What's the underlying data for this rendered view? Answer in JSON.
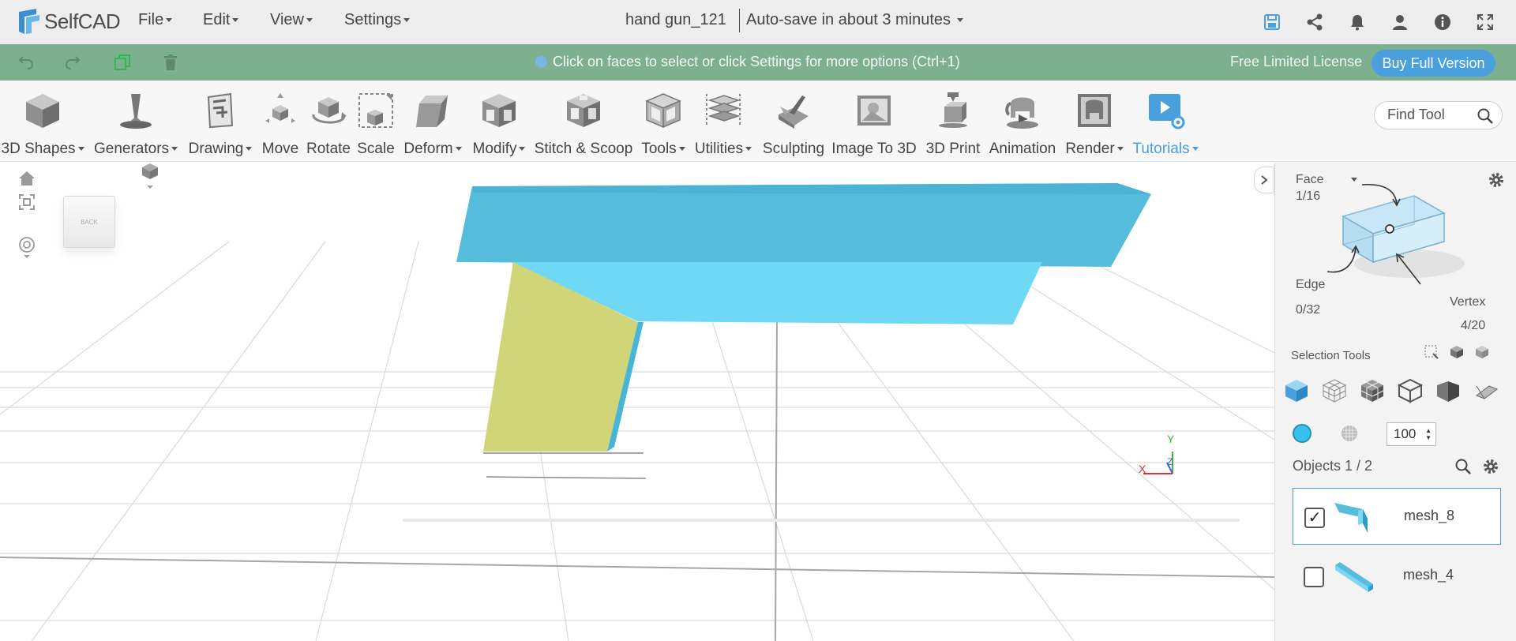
{
  "app": {
    "name": "SelfCAD",
    "brand_color": "#4aa0dd"
  },
  "menu": {
    "file": "File",
    "edit": "Edit",
    "view": "View",
    "settings": "Settings"
  },
  "document": {
    "title": "hand gun_121",
    "autosave": "Auto-save in about 3 minutes"
  },
  "info_bar": {
    "hint": "Click on faces to select or click Settings for more options (Ctrl+1)",
    "license": "Free Limited License",
    "buy_button": "Buy Full Version",
    "background": "#7cb08e"
  },
  "toolbar": {
    "items": [
      {
        "label": "3D Shapes",
        "icon": "cube-icon",
        "dropdown": true
      },
      {
        "label": "Generators",
        "icon": "generator-icon",
        "dropdown": true
      },
      {
        "label": "Drawing",
        "icon": "drawing-icon",
        "dropdown": true
      },
      {
        "label": "Move",
        "icon": "move-icon",
        "dropdown": false
      },
      {
        "label": "Rotate",
        "icon": "rotate-icon",
        "dropdown": false
      },
      {
        "label": "Scale",
        "icon": "scale-icon",
        "dropdown": false
      },
      {
        "label": "Deform",
        "icon": "deform-icon",
        "dropdown": true
      },
      {
        "label": "Modify",
        "icon": "modify-icon",
        "dropdown": true
      },
      {
        "label": "Stitch & Scoop",
        "icon": "stitch-scoop-icon",
        "dropdown": false
      },
      {
        "label": "Tools",
        "icon": "tools-icon",
        "dropdown": true
      },
      {
        "label": "Utilities",
        "icon": "utilities-icon",
        "dropdown": true
      },
      {
        "label": "Sculpting",
        "icon": "sculpting-icon",
        "dropdown": false
      },
      {
        "label": "Image To 3D",
        "icon": "image-to-3d-icon",
        "dropdown": false
      },
      {
        "label": "3D Print",
        "icon": "3d-print-icon",
        "dropdown": false
      },
      {
        "label": "Animation",
        "icon": "animation-icon",
        "dropdown": false
      },
      {
        "label": "Render",
        "icon": "render-icon",
        "dropdown": true
      },
      {
        "label": "Tutorials",
        "icon": "tutorials-icon",
        "dropdown": true
      }
    ],
    "find_tool_placeholder": "Find Tool"
  },
  "viewport": {
    "nav_cube_face": "BACK",
    "axis_y": "Y",
    "axis_x": "X",
    "axis_z": "Z"
  },
  "selection_panel": {
    "face_label": "Face",
    "face_count": "1/16",
    "edge_label": "Edge",
    "edge_count": "0/32",
    "vertex_label": "Vertex",
    "vertex_count": "4/20",
    "selection_tools_label": "Selection Tools",
    "opacity_value": "100",
    "object_color": "#36c2ec"
  },
  "objects": {
    "header": "Objects 1 / 2",
    "list": [
      {
        "name": "mesh_8",
        "checked": true
      },
      {
        "name": "mesh_4",
        "checked": false
      }
    ]
  }
}
